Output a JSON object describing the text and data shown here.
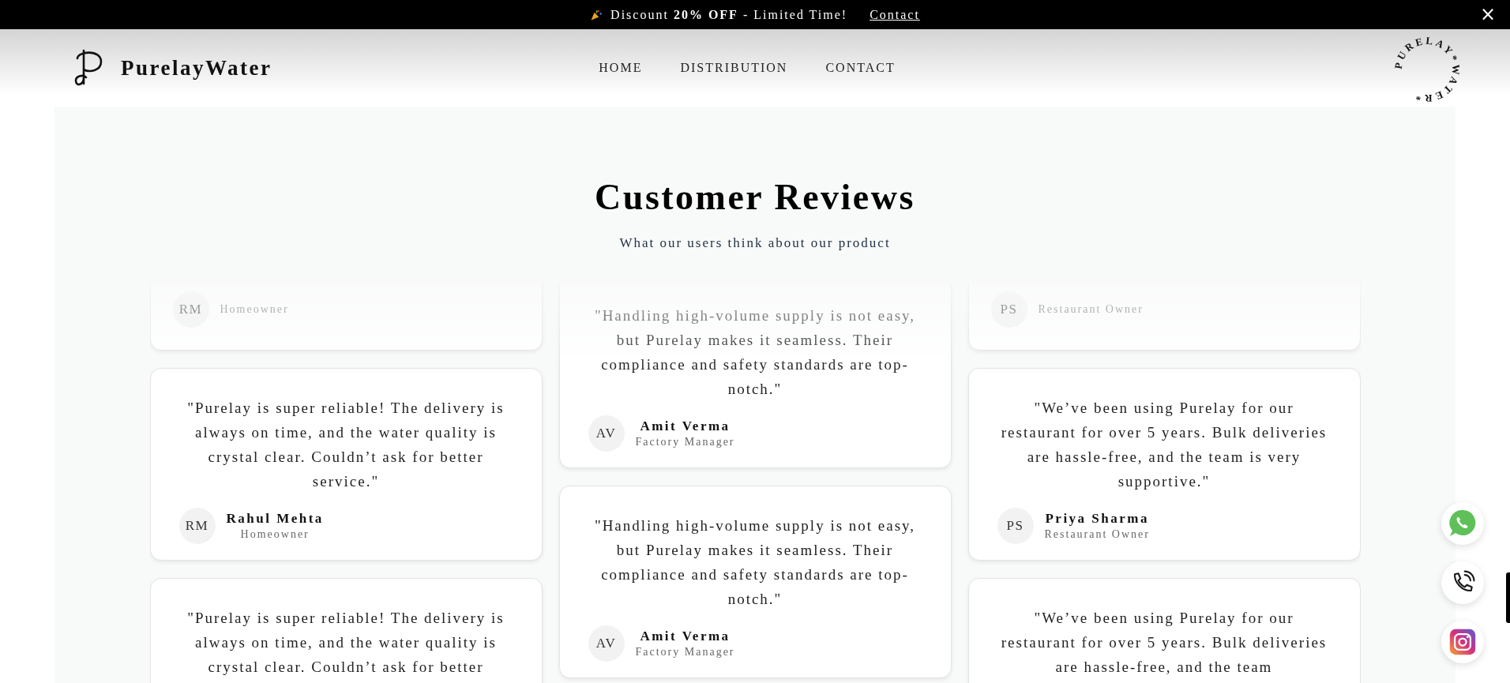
{
  "announcement": {
    "text": "Discount **20% OFF** - Limited Time!",
    "link": "Contact",
    "close": "×"
  },
  "header": {
    "brand": "PurelayWater",
    "nav": [
      {
        "label": "HOME"
      },
      {
        "label": "DISTRIBUTION"
      },
      {
        "label": "CONTACT"
      }
    ],
    "seal": "PURELAY*WATER*"
  },
  "reviews": {
    "title": "Customer Reviews",
    "subtitle": "What our users think about our product",
    "columns": [
      {
        "cards": [
          {
            "kind": "partial",
            "initials": "RM",
            "role": "Homeowner"
          },
          {
            "kind": "full",
            "quote": "\"Purelay is super reliable! The delivery is always on time, and the water quality is crystal clear. Couldn’t ask for better service.\"",
            "initials": "RM",
            "name": "Rahul Mehta",
            "role": "Homeowner"
          },
          {
            "kind": "full",
            "quote": "\"Purelay is super reliable! The delivery is always on time, and the water quality is crystal clear. Couldn’t ask for better"
          }
        ]
      },
      {
        "cards": [
          {
            "kind": "full",
            "quote": "\"Handling high-volume supply is not easy, but Purelay makes it seamless. Their compliance and safety standards are top-notch.\"",
            "initials": "AV",
            "name": "Amit Verma",
            "role": "Factory Manager"
          },
          {
            "kind": "full",
            "quote": "\"Handling high-volume supply is not easy, but Purelay makes it seamless. Their compliance and safety standards are top-notch.\"",
            "initials": "AV",
            "name": "Amit Verma",
            "role": "Factory Manager"
          }
        ]
      },
      {
        "cards": [
          {
            "kind": "partial",
            "initials": "PS",
            "role": "Restaurant Owner"
          },
          {
            "kind": "full",
            "quote": "\"We’ve been using Purelay for our restaurant for over 5 years. Bulk deliveries are hassle-free, and the team is very supportive.\"",
            "initials": "PS",
            "name": "Priya Sharma",
            "role": "Restaurant Owner"
          },
          {
            "kind": "full",
            "quote": "\"We’ve been using Purelay for our restaurant for over 5 years. Bulk deliveries are hassle-free, and the team"
          }
        ]
      }
    ]
  }
}
